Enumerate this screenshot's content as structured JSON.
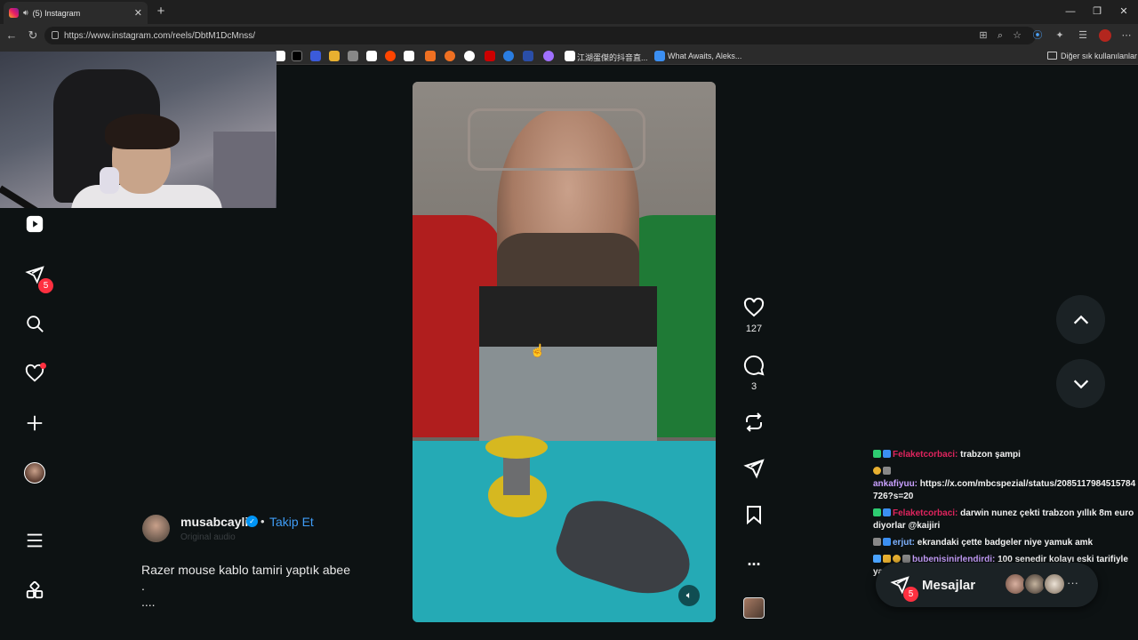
{
  "browser": {
    "tab_title": "(5) Instagram",
    "url": "https://www.instagram.com/reels/DbtM1DcMnss/",
    "bookmarks": {
      "item1": "江湖蛋傑的抖音直...",
      "item2": "What Awaits, Aleks...",
      "other": "Diğer sık kullanılanlar"
    }
  },
  "sidebar": {
    "messages_badge": "5"
  },
  "post": {
    "author": "musabcayli",
    "separator": "•",
    "follow_label": "Takip Et",
    "subline": "Original audio",
    "caption_line1": "Razer mouse kablo tamiri yaptık abee",
    "caption_line2": ".",
    "caption_line3": "...."
  },
  "actions": {
    "likes": "127",
    "comments": "3",
    "more": "..."
  },
  "chat": [
    {
      "nick": "Felaketcorbaci:",
      "text": " trabzon şampi",
      "nick_color": "#e0245e"
    },
    {
      "nick": "ankafiyuu:",
      "text": " https://x.com/mbcspezial/status/2085117984515784726?s=20",
      "nick_color": "#c9a0ff"
    },
    {
      "nick": "Felaketcorbaci:",
      "text": " darwin nunez çekti trabzon yıllık 8m euro diyorlar @kaijiri",
      "nick_color": "#e0245e"
    },
    {
      "nick": "erjut:",
      "text": " ekrandaki çette badgeler niye yamuk amk",
      "nick_color": "#7fb2ff"
    },
    {
      "nick": "bubenisinirlendirdi:",
      "text": " 100 senedir kolayı eski tarifiyle yapıyorum",
      "nick_color": "#c9a0ff"
    }
  ],
  "messages_popup": {
    "label": "Mesajlar",
    "badge": "5",
    "more": "···"
  },
  "colors": {
    "accent_blue": "#0095f6",
    "badge_red": "#ff3040",
    "background": "#0d1213"
  }
}
